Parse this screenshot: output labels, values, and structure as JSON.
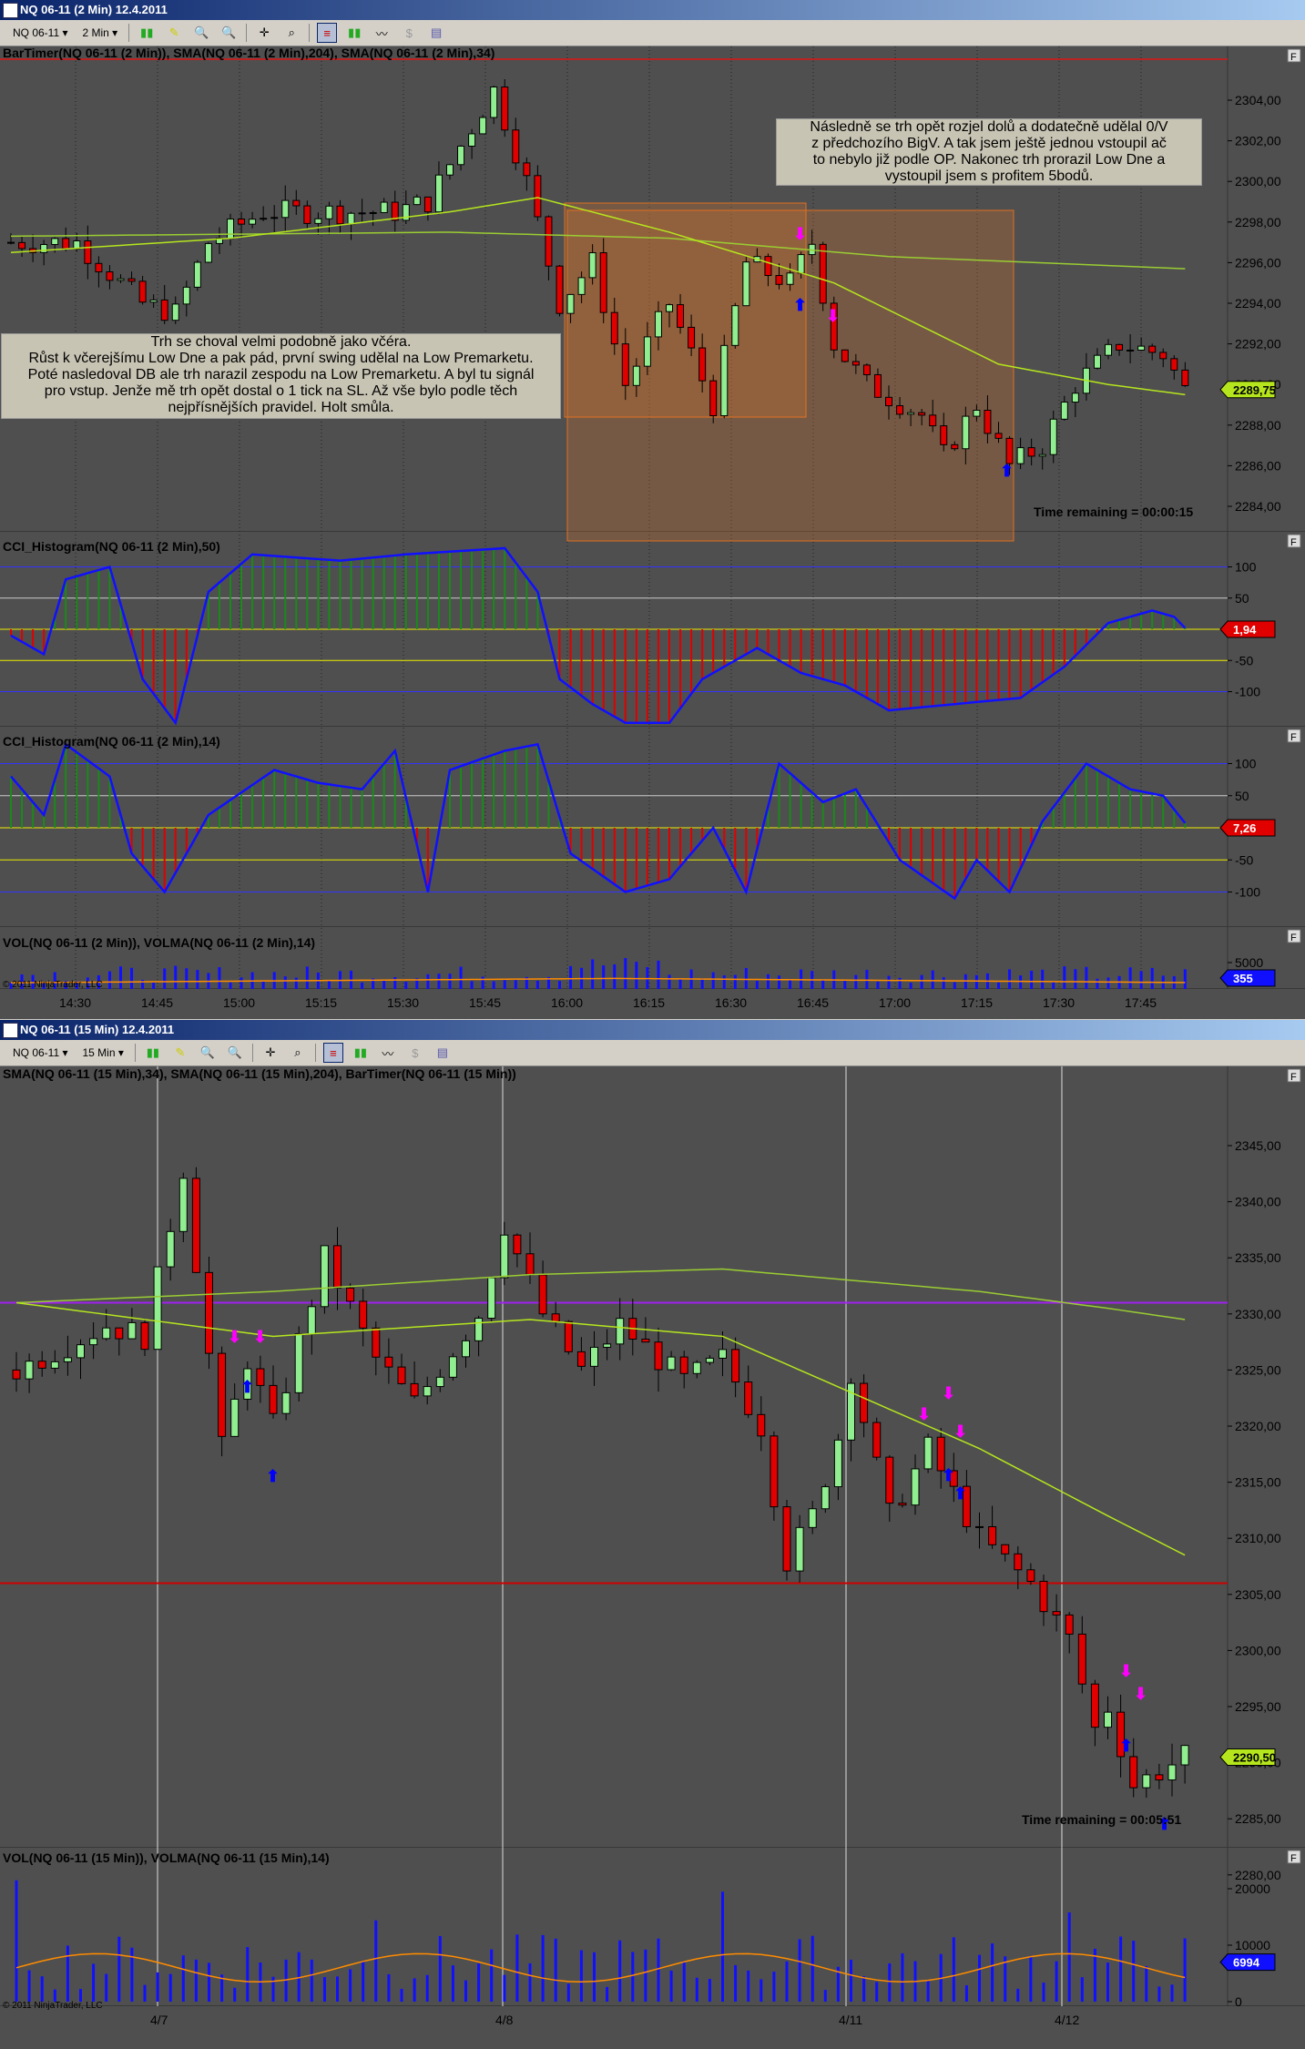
{
  "top": {
    "title": "NQ 06-11 (2 Min)  12.4.2011",
    "toolbar": {
      "instrument": "NQ 06-11",
      "interval": "2 Min"
    },
    "price_panel": {
      "label": "BarTimer(NQ 06-11 (2 Min)), SMA(NQ 06-11 (2 Min),204), SMA(NQ 06-11 (2 Min),34)",
      "axis": [
        "2304,00",
        "2302,00",
        "2300,00",
        "2298,00",
        "2296,00",
        "2294,00",
        "2292,00",
        "2290,00",
        "2288,00",
        "2286,00",
        "2284,00"
      ],
      "axis_values": [
        2304,
        2302,
        2300,
        2298,
        2296,
        2294,
        2292,
        2290,
        2288,
        2286,
        2284
      ],
      "last_price": "2289,75",
      "time_remaining": "Time remaining = 00:00:15",
      "bars": 108,
      "price_path": [
        [
          0,
          2297
        ],
        [
          6,
          2297
        ],
        [
          12,
          2294
        ],
        [
          15,
          2293.5
        ],
        [
          18,
          2297
        ],
        [
          23,
          2298.5
        ],
        [
          35,
          2298.5
        ],
        [
          38,
          2299
        ],
        [
          44,
          2304.5
        ],
        [
          47,
          2300
        ],
        [
          50,
          2294
        ],
        [
          53,
          2296
        ],
        [
          56,
          2290
        ],
        [
          60,
          2294
        ],
        [
          64,
          2289
        ],
        [
          67,
          2296
        ],
        [
          71,
          2295
        ],
        [
          73,
          2297
        ],
        [
          75,
          2292
        ],
        [
          78,
          2290
        ],
        [
          83,
          2288.5
        ],
        [
          85,
          2286.5
        ],
        [
          88,
          2289
        ],
        [
          91,
          2286
        ],
        [
          94,
          2287
        ],
        [
          97,
          2290
        ],
        [
          101,
          2292
        ],
        [
          105,
          2291.5
        ],
        [
          107,
          2289.75
        ]
      ],
      "sma34_path": [
        [
          0,
          2296.5
        ],
        [
          20,
          2297.2
        ],
        [
          40,
          2298.5
        ],
        [
          48,
          2299.2
        ],
        [
          60,
          2297.5
        ],
        [
          75,
          2295
        ],
        [
          90,
          2291
        ],
        [
          100,
          2290
        ],
        [
          107,
          2289.5
        ]
      ],
      "sma204_path": [
        [
          0,
          2297.3
        ],
        [
          40,
          2297.5
        ],
        [
          60,
          2297.2
        ],
        [
          80,
          2296.3
        ],
        [
          107,
          2295.7
        ]
      ],
      "note_left": [
        "Trh se choval velmi podobně jako včéra.",
        "Růst k včerejšímu Low Dne a pak pád, první swing udělal na Low Premarketu.",
        "Poté nasledoval DB ale trh narazil zespodu na Low Premarketu. A byl tu signál",
        "pro vstup. Jenže mě trh opět dostal o 1 tick na SL. Až vše bylo podle těch",
        "nejpřísnějších pravidel. Holt smůla."
      ],
      "note_right": [
        "Následně se trh opět rozjel dolů a dodatečně udělal 0/V",
        "z předchozího BigV. A tak jsem ještě jednou vstoupil ač",
        "to nebylo již podle OP. Nakonec trh prorazil Low Dne  a",
        "vystoupil jsem s profitem 5bodů."
      ]
    },
    "cci50": {
      "label": "CCI_Histogram(NQ 06-11 (2 Min),50)",
      "axis": [
        "100",
        "50",
        "-50",
        "-100"
      ],
      "axis_values": [
        100,
        50,
        -50,
        -100
      ],
      "last": "1,94",
      "path": [
        [
          0,
          -10
        ],
        [
          3,
          -40
        ],
        [
          5,
          80
        ],
        [
          9,
          100
        ],
        [
          12,
          -80
        ],
        [
          15,
          -150
        ],
        [
          18,
          60
        ],
        [
          22,
          120
        ],
        [
          30,
          110
        ],
        [
          36,
          120
        ],
        [
          45,
          130
        ],
        [
          48,
          60
        ],
        [
          50,
          -80
        ],
        [
          53,
          -120
        ],
        [
          56,
          -150
        ],
        [
          60,
          -150
        ],
        [
          63,
          -80
        ],
        [
          68,
          -30
        ],
        [
          72,
          -70
        ],
        [
          76,
          -90
        ],
        [
          80,
          -130
        ],
        [
          86,
          -120
        ],
        [
          92,
          -110
        ],
        [
          96,
          -60
        ],
        [
          100,
          10
        ],
        [
          104,
          30
        ],
        [
          106,
          20
        ],
        [
          107,
          1.94
        ]
      ]
    },
    "cci14": {
      "label": "CCI_Histogram(NQ 06-11 (2 Min),14)",
      "axis": [
        "100",
        "50",
        "-50",
        "-100"
      ],
      "axis_values": [
        100,
        50,
        -50,
        -100
      ],
      "last": "7,26",
      "path": [
        [
          0,
          80
        ],
        [
          3,
          20
        ],
        [
          5,
          130
        ],
        [
          9,
          80
        ],
        [
          11,
          -40
        ],
        [
          14,
          -100
        ],
        [
          18,
          20
        ],
        [
          24,
          90
        ],
        [
          28,
          70
        ],
        [
          32,
          60
        ],
        [
          35,
          120
        ],
        [
          38,
          -100
        ],
        [
          40,
          90
        ],
        [
          45,
          120
        ],
        [
          48,
          130
        ],
        [
          51,
          -40
        ],
        [
          56,
          -100
        ],
        [
          60,
          -80
        ],
        [
          64,
          0
        ],
        [
          67,
          -100
        ],
        [
          70,
          100
        ],
        [
          74,
          40
        ],
        [
          77,
          60
        ],
        [
          81,
          -50
        ],
        [
          86,
          -110
        ],
        [
          88,
          -50
        ],
        [
          91,
          -100
        ],
        [
          94,
          10
        ],
        [
          98,
          100
        ],
        [
          102,
          60
        ],
        [
          105,
          50
        ],
        [
          107,
          7.26
        ]
      ]
    },
    "volume": {
      "label": "VOL(NQ 06-11 (2 Min)), VOLMA(NQ 06-11 (2 Min),14)",
      "axis": [
        "5000"
      ],
      "last": "355",
      "copyright": "© 2011 NinjaTrader, LLC"
    },
    "time_axis": [
      "14:30",
      "14:45",
      "15:00",
      "15:15",
      "15:30",
      "15:45",
      "16:00",
      "16:15",
      "16:30",
      "16:45",
      "17:00",
      "17:15",
      "17:30",
      "17:45"
    ]
  },
  "bottom": {
    "title": "NQ 06-11 (15 Min)  12.4.2011",
    "toolbar": {
      "instrument": "NQ 06-11",
      "interval": "15 Min"
    },
    "price_panel": {
      "label": "SMA(NQ 06-11 (15 Min),34), SMA(NQ 06-11 (15 Min),204), BarTimer(NQ 06-11 (15 Min))",
      "axis": [
        "2345,00",
        "2340,00",
        "2335,00",
        "2330,00",
        "2325,00",
        "2320,00",
        "2315,00",
        "2310,00",
        "2305,00",
        "2300,00",
        "2295,00",
        "2290,00",
        "2285,00",
        "2280,00"
      ],
      "axis_values": [
        2345,
        2340,
        2335,
        2330,
        2325,
        2320,
        2315,
        2310,
        2305,
        2300,
        2295,
        2290,
        2285,
        2280
      ],
      "last_price": "2290,50",
      "time_remaining": "Time remaining = 00:05:51",
      "bars": 92,
      "price_path": [
        [
          0,
          2325
        ],
        [
          7,
          2329
        ],
        [
          10,
          2328
        ],
        [
          13,
          2343
        ],
        [
          16,
          2318
        ],
        [
          18,
          2326
        ],
        [
          20,
          2320
        ],
        [
          24,
          2335
        ],
        [
          28,
          2326
        ],
        [
          31,
          2322
        ],
        [
          36,
          2330
        ],
        [
          38,
          2338
        ],
        [
          41,
          2330
        ],
        [
          44,
          2325
        ],
        [
          47,
          2329
        ],
        [
          52,
          2324
        ],
        [
          55,
          2326
        ],
        [
          58,
          2320
        ],
        [
          60,
          2308
        ],
        [
          62,
          2312
        ],
        [
          64,
          2319
        ],
        [
          65,
          2325
        ],
        [
          68,
          2312
        ],
        [
          71,
          2318
        ],
        [
          75,
          2310
        ],
        [
          79,
          2306
        ],
        [
          82,
          2301
        ],
        [
          84,
          2293
        ],
        [
          85,
          2295
        ],
        [
          87,
          2288
        ],
        [
          91,
          2290.5
        ]
      ],
      "sma34_path": [
        [
          0,
          2331
        ],
        [
          10,
          2329.5
        ],
        [
          20,
          2328
        ],
        [
          40,
          2329.5
        ],
        [
          55,
          2328
        ],
        [
          65,
          2323
        ],
        [
          75,
          2318
        ],
        [
          85,
          2312
        ],
        [
          91,
          2308.5
        ]
      ],
      "sma204_path": [
        [
          0,
          2331
        ],
        [
          20,
          2332
        ],
        [
          40,
          2333.5
        ],
        [
          55,
          2334
        ],
        [
          75,
          2332
        ],
        [
          85,
          2330.5
        ],
        [
          91,
          2329.5
        ]
      ],
      "hlines": [
        2331,
        2306
      ]
    },
    "volume": {
      "label": "VOL(NQ 06-11 (15 Min)), VOLMA(NQ 06-11 (15 Min),14)",
      "axis": [
        "20000",
        "10000",
        "0"
      ],
      "axis_values": [
        20000,
        10000,
        0
      ],
      "last": "6994",
      "copyright": "© 2011 NinjaTrader, LLC"
    },
    "date_axis": [
      "4/7",
      "4/8",
      "4/11",
      "4/12"
    ]
  },
  "colors": {
    "bg": "#4f4f4f",
    "up": "#90ee90",
    "down": "#e00000",
    "sma34": "#b5e61d",
    "sma204": "#9acd32",
    "cci": "#1010ff",
    "vol": "#1010ff",
    "volma": "#ff8c00"
  }
}
